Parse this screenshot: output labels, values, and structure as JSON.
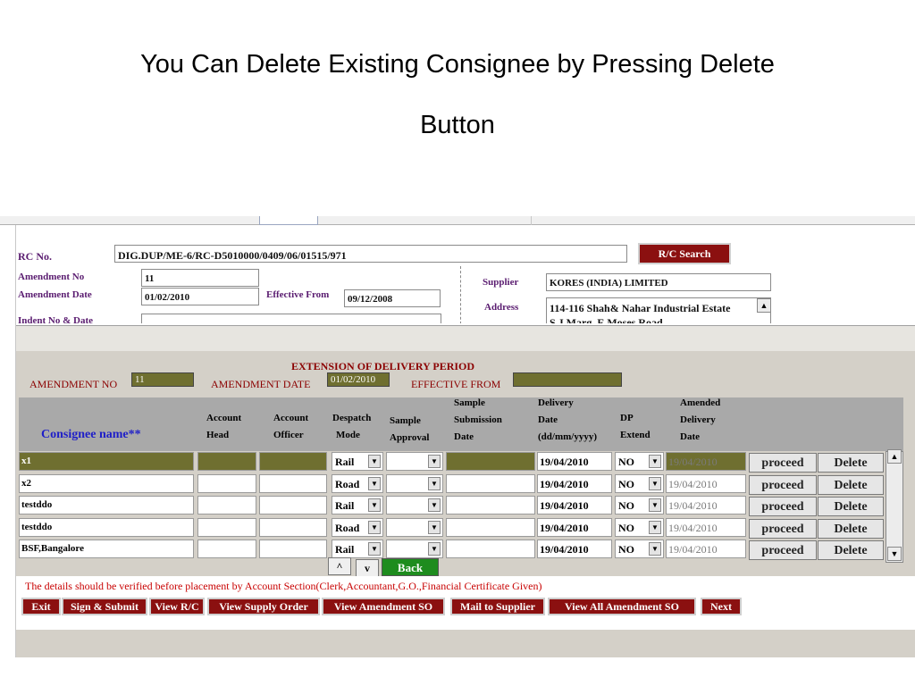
{
  "slide": {
    "title_line1": "You Can Delete Existing Consignee by Pressing Delete",
    "title_line2": "Button"
  },
  "form": {
    "rc_no_label": "RC No.",
    "rc_no_value": "DIG.DUP/ME-6/RC-D5010000/0409/06/01515/971",
    "rc_search_label": "R/C Search",
    "amendment_no_label": "Amendment No",
    "amendment_no_value": "11",
    "amendment_date_label": "Amendment Date",
    "amendment_date_value": "01/02/2010",
    "effective_from_label": "Effective From",
    "effective_from_value": "09/12/2008",
    "indent_label": "Indent No & Date",
    "supplier_label": "Supplier",
    "supplier_value": "KORES (INDIA) LIMITED",
    "address_label": "Address",
    "address_value": "114-116 Shah& Nahar Industrial Estate",
    "address_value2": "S.J.Marg, E.Moses Road"
  },
  "extension": {
    "title": "EXTENSION OF DELIVERY PERIOD",
    "amendment_no_label": "AMENDMENT NO",
    "amendment_no_value": "11",
    "amendment_date_label": "AMENDMENT DATE",
    "amendment_date_value": "01/02/2010",
    "effective_from_label": "EFFECTIVE FROM",
    "effective_from_value": ""
  },
  "table": {
    "headers": {
      "consignee": "Consignee name**",
      "account_head_1": "Account",
      "account_head_2": "Head",
      "account_officer_1": "Account",
      "account_officer_2": "Officer",
      "despatch_1": "Despatch",
      "despatch_2": "Mode",
      "sample_approval_1": "Sample",
      "sample_approval_2": "Approval",
      "sample_sub_1": "Sample",
      "sample_sub_2": "Submission",
      "sample_sub_3": "Date",
      "delivery_1": "Delivery",
      "delivery_2": "Date",
      "delivery_3": "(dd/mm/yyyy)",
      "dp_1": "DP",
      "dp_2": "Extend",
      "amended_1": "Amended",
      "amended_2": "Delivery",
      "amended_3": "Date"
    },
    "rows": [
      {
        "consignee": "x1",
        "despatch": "Rail",
        "delivery": "19/04/2010",
        "dp": "NO",
        "amended": "19/04/2010",
        "proceed": "proceed",
        "delete": "Delete"
      },
      {
        "consignee": "x2",
        "despatch": "Road",
        "delivery": "19/04/2010",
        "dp": "NO",
        "amended": "19/04/2010",
        "proceed": "proceed",
        "delete": "Delete"
      },
      {
        "consignee": "testddo",
        "despatch": "Rail",
        "delivery": "19/04/2010",
        "dp": "NO",
        "amended": "19/04/2010",
        "proceed": "proceed",
        "delete": "Delete"
      },
      {
        "consignee": "testddo",
        "despatch": "Road",
        "delivery": "19/04/2010",
        "dp": "NO",
        "amended": "19/04/2010",
        "proceed": "proceed",
        "delete": "Delete"
      },
      {
        "consignee": "BSF,Bangalore",
        "despatch": "Rail",
        "delivery": "19/04/2010",
        "dp": "NO",
        "amended": "19/04/2010",
        "proceed": "proceed",
        "delete": "Delete"
      }
    ]
  },
  "nav": {
    "up": "^",
    "down": "v",
    "back": "Back"
  },
  "footer": {
    "note": "The details should be verified before placement by Account Section(Clerk,Accountant,G.O.,Financial Certificate Given)",
    "buttons": [
      "Exit",
      "Sign & Submit",
      "View R/C",
      "View Supply Order",
      "View Amendment SO",
      "Mail to Supplier",
      "View All Amendment SO",
      "Next"
    ]
  },
  "colors": {
    "maroon_button": "#8b1010",
    "selected_row": "#6f6f30",
    "back_green": "#1e8c1e",
    "header_gray": "#a9a9a9",
    "label_purple": "#5a1c70",
    "consignee_blue": "#1e1ec8"
  },
  "icons": {
    "dropdown": "▼",
    "scroll_up": "▲",
    "scroll_down": "▼"
  }
}
